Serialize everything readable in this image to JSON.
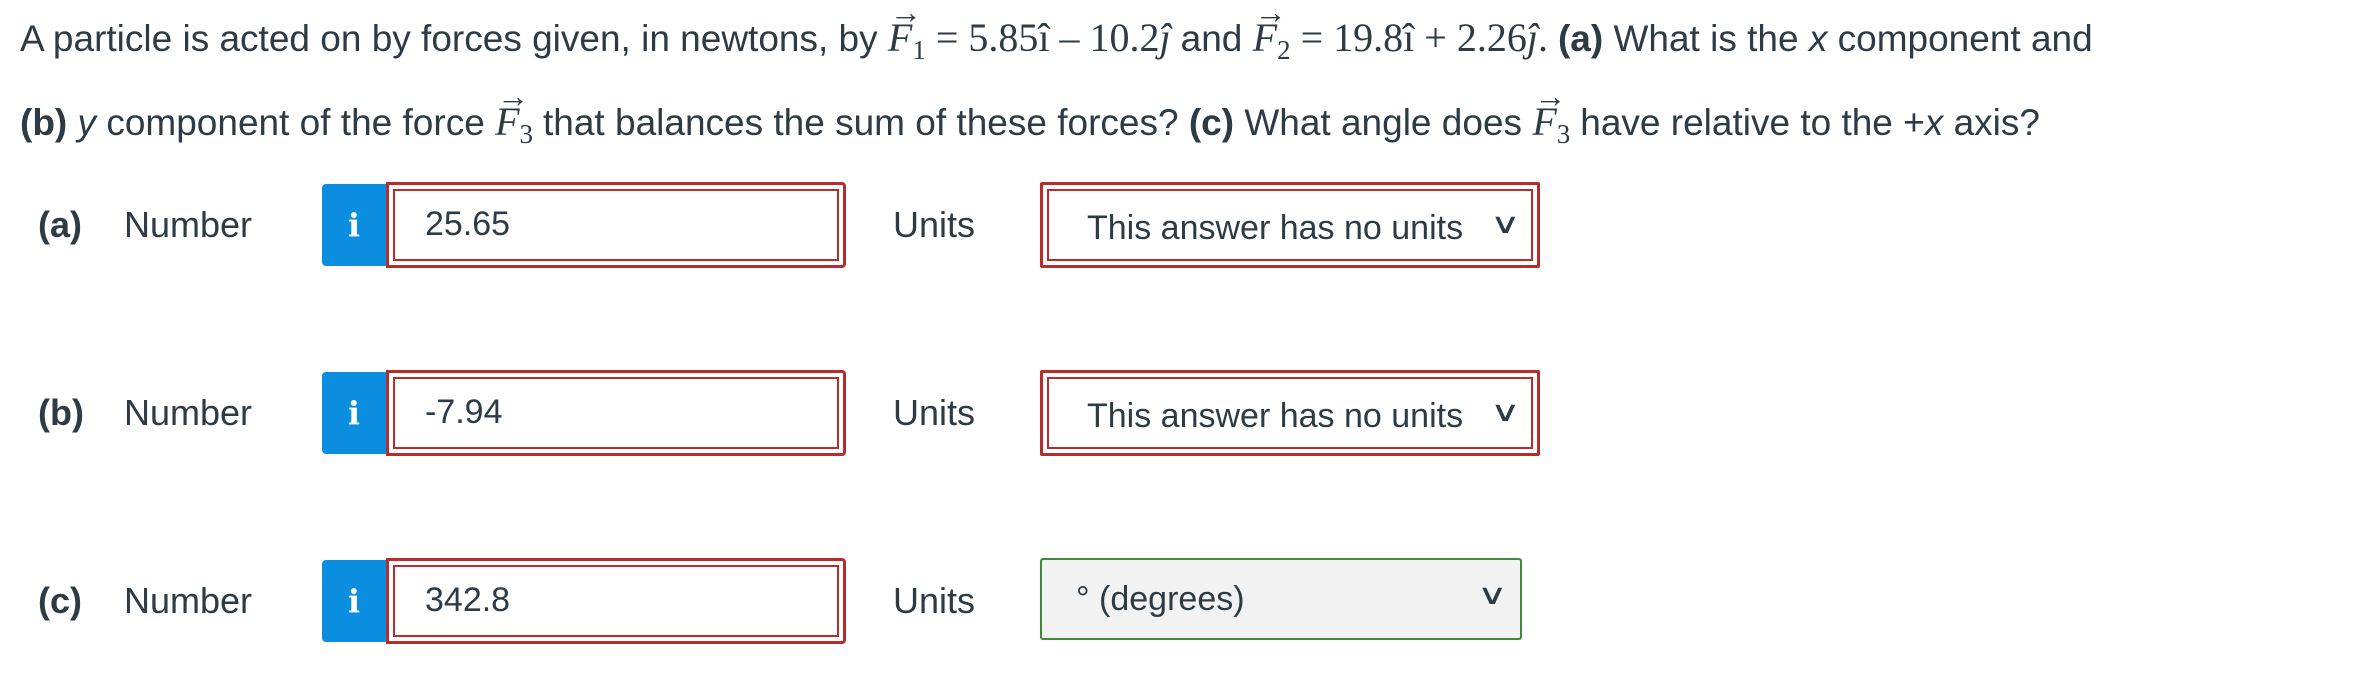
{
  "question": {
    "intro": "A particle is acted on by forces given, in newtons, by",
    "f1_symbol": "F",
    "f1_sub": "1",
    "f1_expr": "= 5.85î – 10.2",
    "j_hat": "ĵ",
    "and_word": "and",
    "f2_symbol": "F",
    "f2_sub": "2",
    "f2_expr": "= 19.8î + 2.26",
    "period": ".",
    "part_a_tag": "(a)",
    "part_a_text1": "What is the",
    "x_var": "x",
    "part_a_text2": "component and",
    "part_b_tag": "(b)",
    "y_var": "y",
    "part_b_text": "component of the force",
    "f3_symbol": "F",
    "f3_sub": "3",
    "part_b_text2": "that balances the sum of these forces?",
    "part_c_tag": "(c)",
    "part_c_text1": "What angle does",
    "part_c_text2": "have relative to the +",
    "x_var2": "x",
    "part_c_text3": "axis?",
    "arrow_glyph": "→"
  },
  "rows": [
    {
      "tag": "(a)",
      "number_label": "Number",
      "info_icon": "i",
      "value": "25.65",
      "units_label": "Units",
      "units_value": "This answer has no units",
      "chevron": "∨"
    },
    {
      "tag": "(b)",
      "number_label": "Number",
      "info_icon": "i",
      "value": "-7.94",
      "units_label": "Units",
      "units_value": "This answer has no units",
      "chevron": "∨"
    },
    {
      "tag": "(c)",
      "number_label": "Number",
      "info_icon": "i",
      "value": "342.8",
      "units_label": "Units",
      "units_value": "° (degrees)",
      "chevron": "∨"
    }
  ],
  "colors": {
    "text": "#2d3b45",
    "info_button": "#0b8ee0",
    "error_border": "#b82c2c",
    "correct_border": "#3d8a3d"
  }
}
